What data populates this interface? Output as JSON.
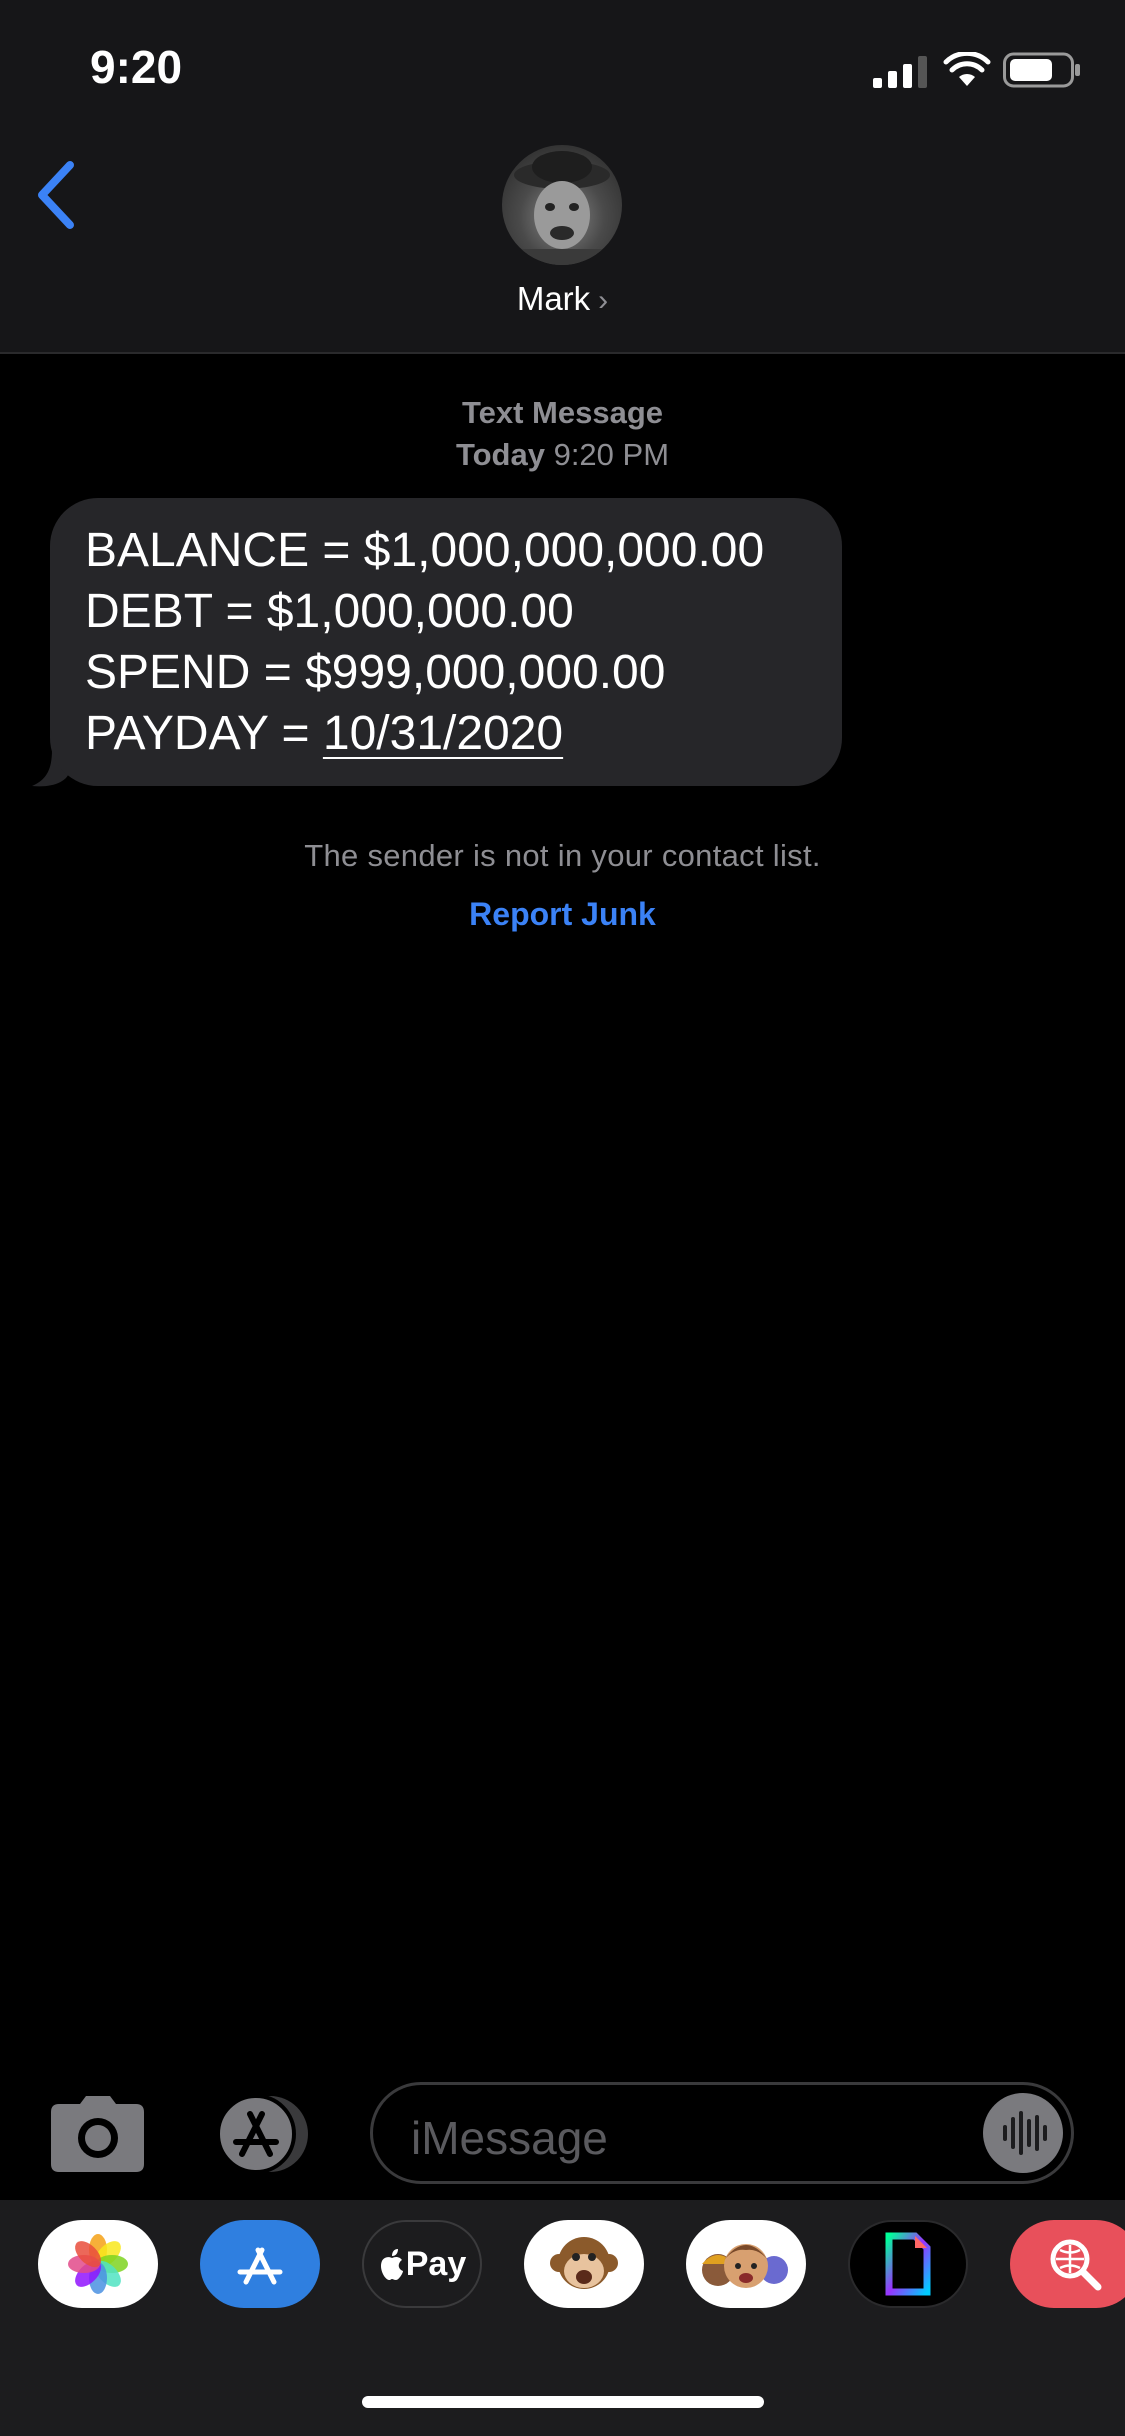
{
  "status_bar": {
    "time": "9:20"
  },
  "header": {
    "contact_name": "Mark",
    "chevron": "›"
  },
  "conversation": {
    "service_label": "Text Message",
    "day_label": "Today",
    "time_label": "9:20 PM",
    "message": {
      "line1": "BALANCE = $1,000,000,000.00",
      "line2": "DEBT = $1,000,000.00",
      "line3": "SPEND = $999,000,000.00",
      "line4_prefix": "PAYDAY = ",
      "line4_date": "10/31/2020"
    },
    "sender_note": "The sender is not in your contact list.",
    "report_junk": "Report Junk"
  },
  "input_bar": {
    "placeholder": "iMessage"
  },
  "app_drawer": {
    "apps": [
      {
        "icon": "photos-icon"
      },
      {
        "icon": "app-store-icon"
      },
      {
        "icon": "apple-pay-icon",
        "label": "Pay"
      },
      {
        "icon": "animoji-monkey-icon"
      },
      {
        "icon": "memoji-icon"
      },
      {
        "icon": "gif-icon"
      },
      {
        "icon": "web-search-icon"
      }
    ]
  },
  "colors": {
    "accent": "#3b82f6",
    "bubble": "#262629",
    "header_bg": "#161618",
    "secondary_text": "#8e8e93"
  }
}
